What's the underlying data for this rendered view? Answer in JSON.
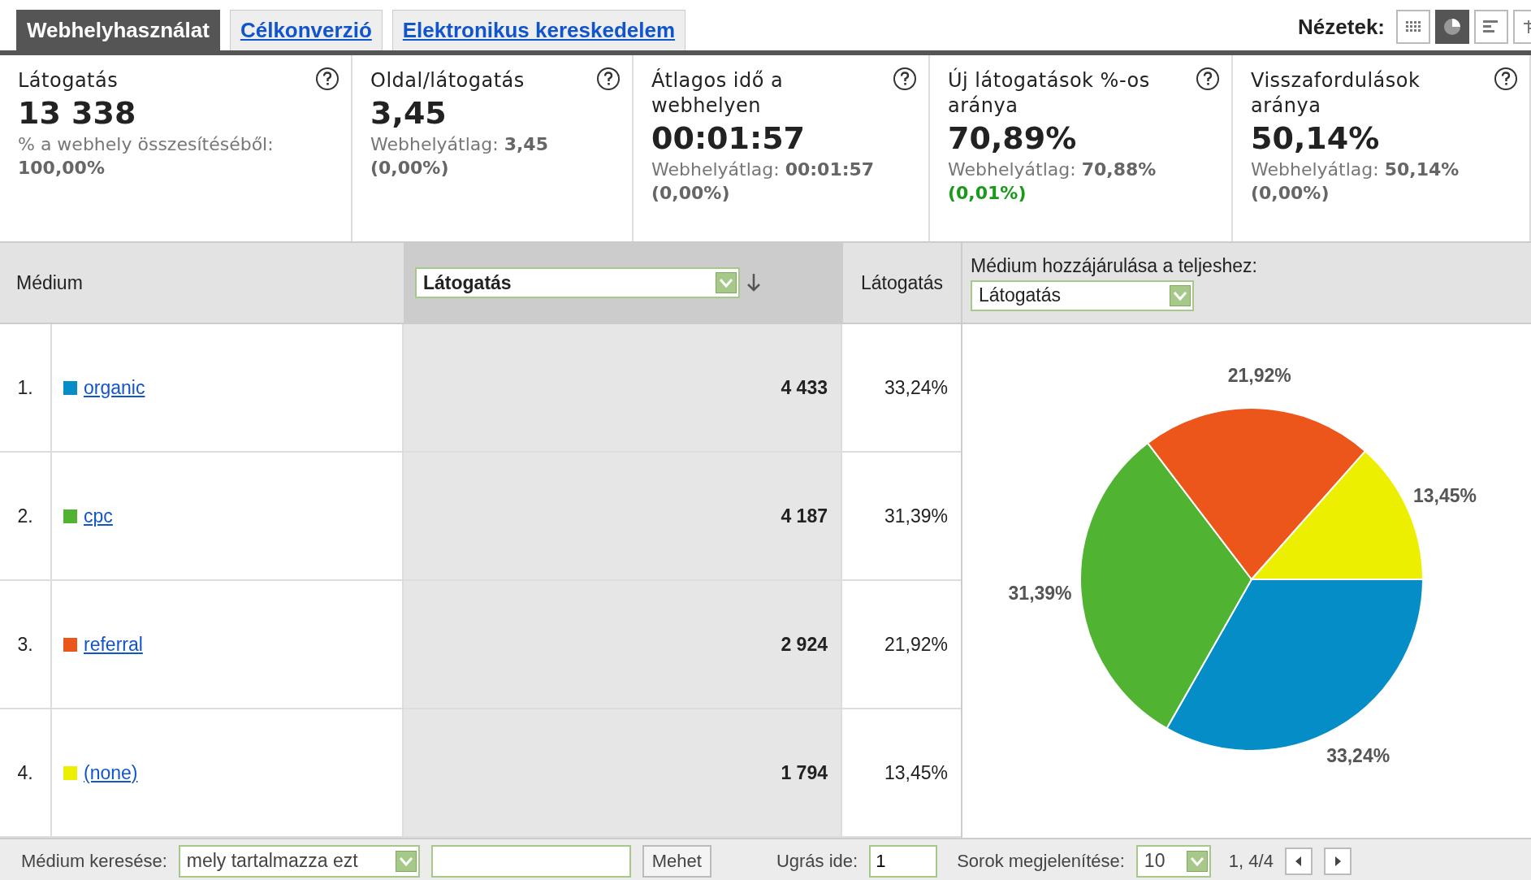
{
  "tabs": [
    {
      "label": "Webhelyhasználat",
      "selected": true
    },
    {
      "label": "Célkonverzió",
      "selected": false
    },
    {
      "label": "Elektronikus kereskedelem",
      "selected": false
    }
  ],
  "views": {
    "label": "Nézetek:",
    "buttons": [
      {
        "kind": "table",
        "selected": false
      },
      {
        "kind": "pie",
        "selected": true
      },
      {
        "kind": "bars",
        "selected": false
      },
      {
        "kind": "pivot",
        "selected": false
      }
    ]
  },
  "metrics": [
    {
      "title": "Látogatás",
      "value": "13 338",
      "caption_label": "% a webhely összesítéséből:",
      "caption_value": "100,00%"
    },
    {
      "title": "Oldal/látogatás",
      "value": "3,45",
      "caption_label": "Webhelyátlag:",
      "caption_value": "3,45",
      "change": "(0,00%)",
      "highlight": false
    },
    {
      "title": "Átlagos idő a webhelyen",
      "value": "00:01:57",
      "caption_label": "Webhelyátlag:",
      "caption_value": "00:01:57",
      "change": "(0,00%)",
      "highlight": false
    },
    {
      "title": "Új látogatások %-os aránya",
      "value": "70,89%",
      "caption_label": "Webhelyátlag:",
      "caption_value": "70,88%",
      "change": "(0,01%)",
      "highlight": true
    },
    {
      "title": "Visszafordulások aránya",
      "value": "50,14%",
      "caption_label": "Webhelyátlag:",
      "caption_value": "50,14%",
      "change": "(0,00%)",
      "highlight": false
    }
  ],
  "table": {
    "dimension_header": "Médium",
    "metric_select": "Látogatás",
    "share_header": "Látogatás",
    "contribution_label": "Médium hozzájárulása a teljeshez:",
    "contribution_select": "Látogatás",
    "rows": [
      {
        "rank": "1.",
        "medium": "organic",
        "color": "#058dc7",
        "visits": "4 433",
        "share": "33,24%"
      },
      {
        "rank": "2.",
        "medium": "cpc",
        "color": "#50b432",
        "visits": "4 187",
        "share": "31,39%"
      },
      {
        "rank": "3.",
        "medium": "referral",
        "color": "#ed561b",
        "visits": "2 924",
        "share": "21,92%"
      },
      {
        "rank": "4.",
        "medium": "(none)",
        "color": "#edef00",
        "visits": "1 794",
        "share": "13,45%"
      }
    ]
  },
  "chart_data": {
    "type": "pie",
    "values": [
      33.24,
      31.39,
      21.92,
      13.45
    ],
    "colors": [
      "#058dc7",
      "#50b432",
      "#ed561b",
      "#edef00"
    ],
    "value_labels": [
      "33,24%",
      "31,39%",
      "21,92%",
      "13,45%"
    ]
  },
  "footer": {
    "search_label": "Médium keresése:",
    "filter_select": "mely tartalmazza ezt",
    "go_button": "Mehet",
    "jump_label": "Ugrás ide:",
    "jump_value": "1",
    "rows_label": "Sorok megjelenítése:",
    "rows_select": "10",
    "range": "1, 4/4"
  }
}
